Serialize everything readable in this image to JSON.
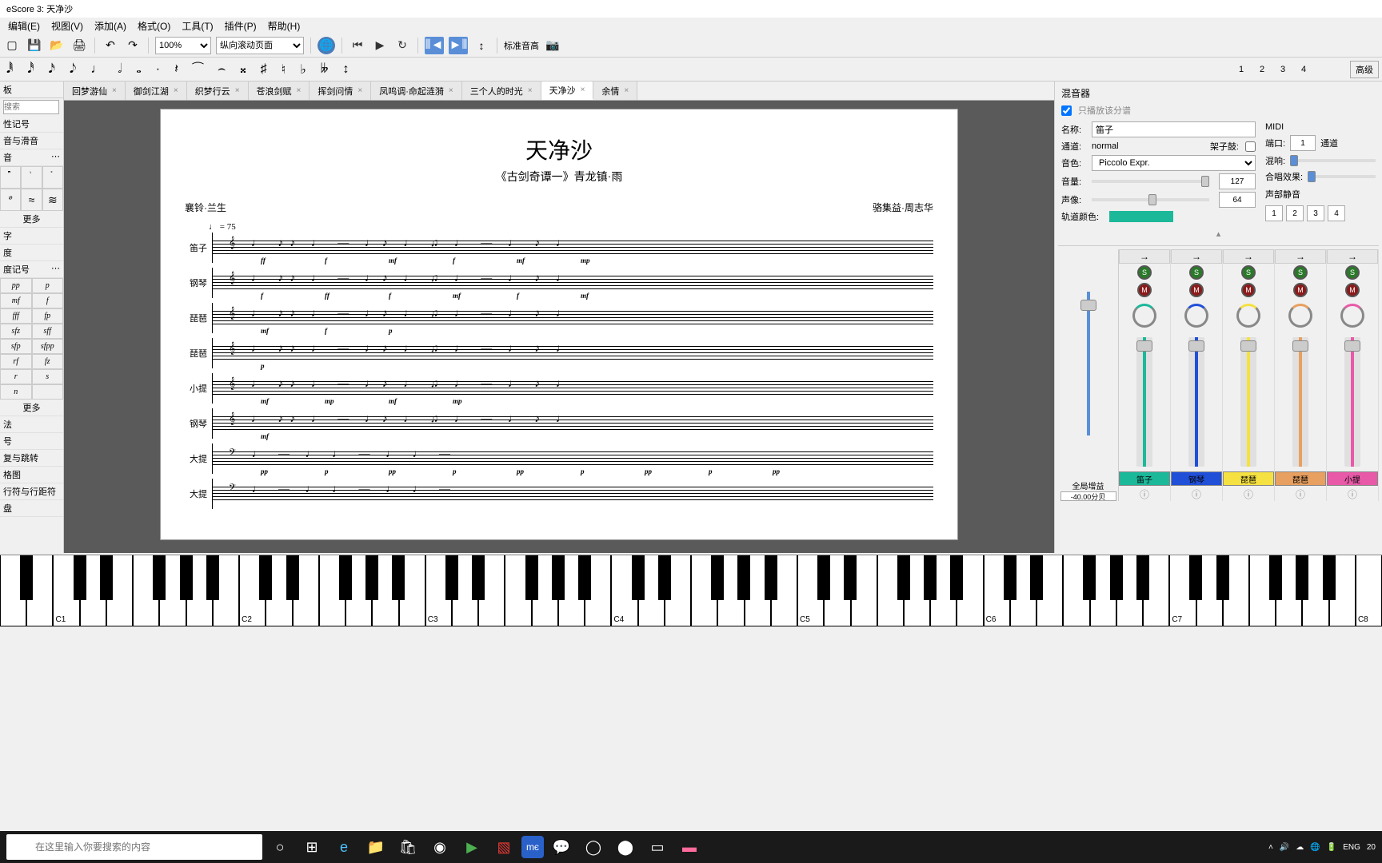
{
  "window_title": "eScore 3: 天净沙",
  "menus": [
    "编辑(E)",
    "视图(V)",
    "添加(A)",
    "格式(O)",
    "工具(T)",
    "插件(P)",
    "帮助(H)"
  ],
  "toolbar": {
    "zoom": "100%",
    "page_mode": "纵向滚动页面",
    "pitch_label": "标准音高",
    "advanced": "高级"
  },
  "voice_numbers": [
    "1",
    "2",
    "3",
    "4"
  ],
  "palette": {
    "header": "板",
    "search_placeholder": "搜索",
    "sections_top": [
      "性记号",
      "音与滑音",
      "音"
    ],
    "more": "更多",
    "sections_mid": [
      "字",
      "度",
      "度记号"
    ],
    "dynamics": [
      [
        "pp",
        "p"
      ],
      [
        "mf",
        "f"
      ],
      [
        "fff",
        "fp"
      ],
      [
        "sfz",
        "sff"
      ],
      [
        "sfp",
        "sfpp"
      ],
      [
        "rf",
        "fz"
      ],
      [
        "r",
        "s"
      ],
      [
        "n",
        ""
      ]
    ],
    "sections_bot": [
      "法",
      "号",
      "复与跳转",
      "格图",
      "行符与行距符",
      "盘"
    ]
  },
  "tabs": [
    {
      "label": "回梦游仙",
      "active": false
    },
    {
      "label": "御剑江湖",
      "active": false
    },
    {
      "label": "织梦行云",
      "active": false
    },
    {
      "label": "苍浪剑赋",
      "active": false
    },
    {
      "label": "挥剑问情",
      "active": false
    },
    {
      "label": "凤鸣调·命起涟漪",
      "active": false
    },
    {
      "label": "三个人的时光",
      "active": false
    },
    {
      "label": "天净沙",
      "active": true
    },
    {
      "label": "余情",
      "active": false
    }
  ],
  "score": {
    "title": "天净沙",
    "subtitle": "《古剑奇谭一》青龙镇·雨",
    "credit_left": "襄铃·兰生",
    "credit_right": "骆集益·周志华",
    "tempo": "♩ = 75",
    "staves": [
      "笛子",
      "钢琴",
      "琵琶",
      "琵琶",
      "小提",
      "钢琴",
      "大提",
      "大提"
    ]
  },
  "mixer": {
    "title": "混音器",
    "only_play_label": "只播放该分谱",
    "name_label": "名称:",
    "name_value": "笛子",
    "midi_label": "MIDI",
    "channel_label": "通道:",
    "channel_value": "normal",
    "drum_label": "架子鼓:",
    "port_label": "端口:",
    "port_value": "1",
    "ch_label": "通道",
    "sound_label": "音色:",
    "sound_value": "Piccolo Expr.",
    "reverb_label": "混响:",
    "chorus_label": "合唱效果:",
    "volume_label": "音量:",
    "volume_value": "127",
    "mute_section_label": "声部静音",
    "pan_label": "声像:",
    "pan_value": "64",
    "mute_buttons": [
      "1",
      "2",
      "3",
      "4"
    ],
    "color_label": "轨道颜色:",
    "global_gain_label": "全局增益",
    "global_gain_value": "-40.00分贝",
    "tracks": [
      {
        "name": "笛子",
        "color": "#1cb89a",
        "knob_color": "#1cb89a"
      },
      {
        "name": "钢琴",
        "color": "#2050d8",
        "knob_color": "#2050d8"
      },
      {
        "name": "琵琶",
        "color": "#f5e142",
        "knob_color": "#f5e142"
      },
      {
        "name": "琵琶",
        "color": "#e8a060",
        "knob_color": "#e8a060"
      },
      {
        "name": "小提",
        "color": "#e85aa8",
        "knob_color": "#e85aa8"
      }
    ]
  },
  "piano_octaves": [
    "C1",
    "C2",
    "C3",
    "C4",
    "C5",
    "C6",
    "C7",
    "C8"
  ],
  "taskbar": {
    "search_placeholder": "在这里输入你要搜索的内容",
    "lang": "ENG",
    "time": "20"
  }
}
